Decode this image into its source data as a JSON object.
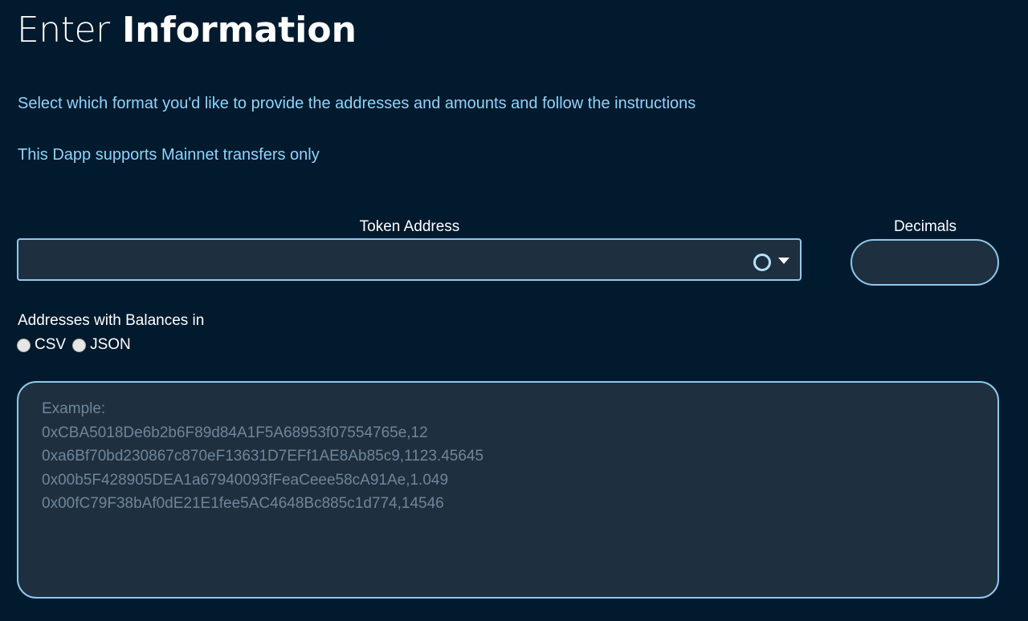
{
  "title": {
    "light": "Enter",
    "bold": "Information"
  },
  "instructions": [
    "Select which format you'd like to provide the addresses and amounts and follow the instructions",
    "This Dapp supports Mainnet transfers only"
  ],
  "token_address": {
    "label": "Token Address",
    "value": ""
  },
  "decimals": {
    "label": "Decimals",
    "value": ""
  },
  "balances": {
    "label": "Addresses with Balances in",
    "options": [
      "CSV",
      "JSON"
    ],
    "selected": null
  },
  "data_input": {
    "placeholder_lines": [
      "Example:",
      "0xCBA5018De6b2b6F89d84A1F5A68953f07554765e,12",
      "0xa6Bf70bd230867c870eF13631D7EFf1AE8Ab85c9,1123.45645",
      "0x00b5F428905DEA1a67940093fFeaCeee58cA91Ae,1.049",
      "0x00fC79F38bAf0dE21E1fee5AC4648Bc885c1d774,14546"
    ]
  },
  "colors": {
    "background": "#011a2e",
    "input_fill": "#1e2f40",
    "input_border": "#90c8ec",
    "info_text": "#8fd3fa",
    "placeholder": "#6f8699"
  }
}
